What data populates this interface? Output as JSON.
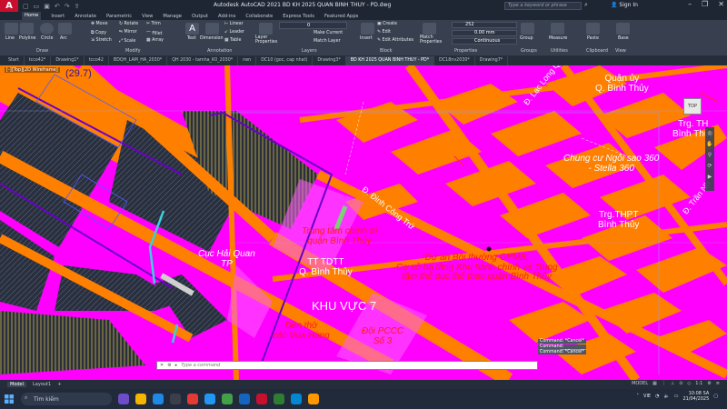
{
  "window": {
    "title": "Autodesk AutoCAD 2021    BD KH 2025 QUAN BINH THUY - PD.dwg",
    "search_placeholder": "Type a keyword or phrase",
    "signin_label": "Sign In"
  },
  "ribbon_tabs": [
    "Home",
    "Insert",
    "Annotate",
    "Parametric",
    "View",
    "Manage",
    "Output",
    "Add-ins",
    "Collaborate",
    "Express Tools",
    "Featured Apps"
  ],
  "ribbon": {
    "draw_tools": [
      "Line",
      "Polyline",
      "Circle",
      "Arc"
    ],
    "modify_tools": [
      "Move",
      "Rotate",
      "Trim",
      "Copy",
      "Mirror",
      "Fillet",
      "Stretch",
      "Scale",
      "Array"
    ],
    "annotation_tools": [
      "Text",
      "Dimension",
      "Linear",
      "Leader",
      "Table"
    ],
    "layer_tools": [
      "Layer Properties",
      "Make Current",
      "Match Layer"
    ],
    "block_tools": [
      "Insert",
      "Create",
      "Edit",
      "Edit Attributes"
    ],
    "properties_tools": [
      "Match Properties",
      "252",
      "0.00 mm",
      "Continuous"
    ],
    "other_tools": [
      "Group",
      "Measure",
      "Paste",
      "Base"
    ],
    "layer_value": "0",
    "panel_titles": [
      "Draw",
      "Modify",
      "Annotation",
      "Layers",
      "Block",
      "Properties",
      "Groups",
      "Utilities",
      "Clipboard",
      "View"
    ]
  },
  "doc_tabs": [
    "Start",
    "tcco42*",
    "Drawing1*",
    "tcco42",
    "BDQH_LAM_HA_2030*",
    "QH 2030 - tamha_K0_2030*",
    "nen",
    "DC10 (goc, cap nhat)",
    "Drawing3*",
    "BD KH 2025 QUAN BINH THUY - PD*",
    "DC18nv2030*",
    "Drawing7*"
  ],
  "viewport_label": "[-][Top][2D Wireframe]",
  "map_labels": {
    "num_297": "(29.7)",
    "quan_uy": "Quận ủy\nQ. Bình Thủy",
    "lac_long_quan": "Đ. Lạc Long Quân",
    "trg_th": "Trg. TH\nBình Thủy",
    "chung_cu": "Chung cư Ngôi sao 360\n- Stella 360",
    "tran": "Đ. Trần Nh",
    "dinh_cong_tru": "Đ. Đinh Công Trứ",
    "trg_thpt": "Trg.THPT\nBình Thủy",
    "trung_tam_ct": "Trung tâm chính trị\nquận Bình Thủy",
    "du_an": "Dự án Bồi thường GPMB,\nCơ sở hạ tầng Khu hành chính và Trung\ntâm thể dục thể thao quận Bình Thủy",
    "cuc_hai_quan": "Cục Hải Quan\nTP",
    "tt_tdtt": "TT TDTT\nQ. Bình Thủy",
    "khu_vuc": "KHU VỰC 7",
    "den_tho": "Đền thờ\ncác Vua Hùng",
    "doi_pccc": "Đội PCCC\nSố 3"
  },
  "viewcube_label": "TOP",
  "command_history": [
    "Command: *Cancel*",
    "Command:",
    "Command: *Cancel*"
  ],
  "command_placeholder": "Type a command",
  "layout_tabs": [
    "Model",
    "Layout1"
  ],
  "status": {
    "model_label": "MODEL",
    "scale": "1:1"
  },
  "taskbar": {
    "search_label": "Tìm kiếm",
    "lang": "VIE",
    "time": "10:08 SA",
    "date": "21/04/2025"
  },
  "colors": {
    "canvas_pink": "#ff00ff",
    "road_orange": "#ff7f00",
    "block_dark": "#2a2f3c",
    "text_red": "#ff1a1a",
    "text_white": "#ffffff",
    "ui_dark": "#38404f"
  }
}
